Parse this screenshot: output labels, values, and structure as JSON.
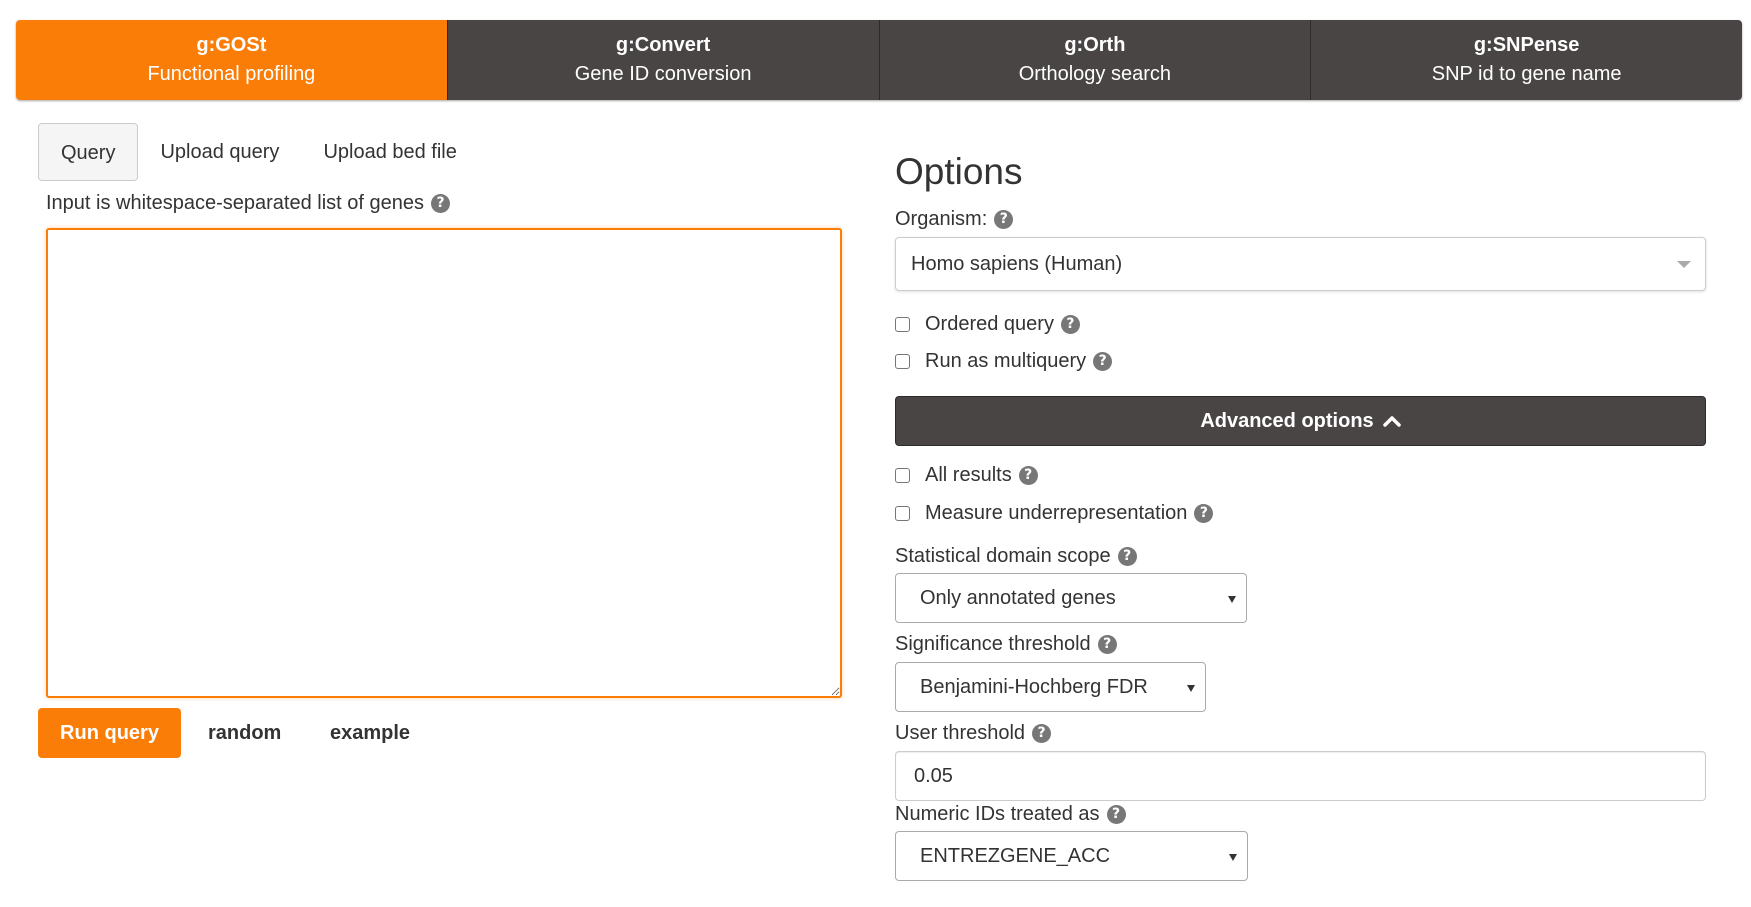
{
  "nav": {
    "tools": [
      {
        "name": "g:GOSt",
        "subtitle": "Functional profiling"
      },
      {
        "name": "g:Convert",
        "subtitle": "Gene ID conversion"
      },
      {
        "name": "g:Orth",
        "subtitle": "Orthology search"
      },
      {
        "name": "g:SNPense",
        "subtitle": "SNP id to gene name"
      }
    ],
    "active_color": "#fa7d07",
    "inactive_color": "#4a4545"
  },
  "query": {
    "tabs": [
      "Query",
      "Upload query",
      "Upload bed file"
    ],
    "active_tab": "Query",
    "input_label": "Input is whitespace-separated list of genes",
    "input_value": "",
    "run_label": "Run query",
    "random_label": "random",
    "example_label": "example"
  },
  "options": {
    "title": "Options",
    "organism_label": "Organism:",
    "organism_value": "Homo sapiens (Human)",
    "ordered_query_label": "Ordered query",
    "ordered_query_checked": false,
    "multiquery_label": "Run as multiquery",
    "multiquery_checked": false,
    "advanced_label": "Advanced options",
    "all_results_label": "All results",
    "all_results_checked": false,
    "underrep_label": "Measure underrepresentation",
    "underrep_checked": false,
    "domain_scope_label": "Statistical domain scope",
    "domain_scope_value": "Only annotated genes",
    "significance_label": "Significance threshold",
    "significance_value": "Benjamini-Hochberg FDR",
    "user_threshold_label": "User threshold",
    "user_threshold_value": "0.05",
    "numeric_ids_label": "Numeric IDs treated as",
    "numeric_ids_value": "ENTREZGENE_ACC"
  },
  "icons": {
    "help": "question-circle-icon",
    "help_glyph": "?",
    "advanced": "chevron-up-icon",
    "organism_caret": "caret-down-icon",
    "select_arrow": "dropdown-arrow-icon"
  }
}
